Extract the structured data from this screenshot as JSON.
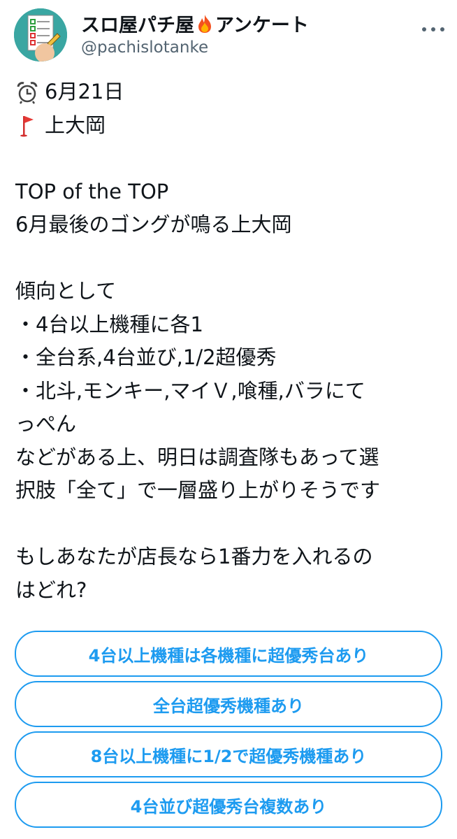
{
  "profile": {
    "display_name": "スロ屋パチ屋",
    "display_name_suffix": "アンケート",
    "fire_emoji_icon": "fire-icon",
    "handle": "@pachislotanke",
    "avatar_icon": "checklist-icon"
  },
  "tweet": {
    "date_icon": "alarm-clock-icon",
    "date": "6月21日",
    "location_icon": "red-flag-icon",
    "location": "上大岡",
    "title": "TOP of the TOP",
    "subtitle": "6月最後のゴングが鳴る上大岡",
    "tendency_heading": "傾向として",
    "bullet1": "・4台以上機種に各1",
    "bullet2": "・全台系,4台並び,1/2超優秀",
    "bullet3a": "・北斗,モンキー,マイＶ,喰種,バラにて",
    "bullet3b": "っぺん",
    "note1": "などがある上、明日は調査隊もあって選",
    "note2": "択肢「全て」で一層盛り上がりそうです",
    "question1": "もしあなたが店長なら1番力を入れるの",
    "question2": "はどれ?"
  },
  "poll": {
    "options": [
      "4台以上機種は各機種に超優秀台あり",
      "全台超優秀機種あり",
      "8台以上機種に1/2で超優秀機種あり",
      "4台並び超優秀台複数あり"
    ],
    "accent_color": "#1d9bf0"
  }
}
